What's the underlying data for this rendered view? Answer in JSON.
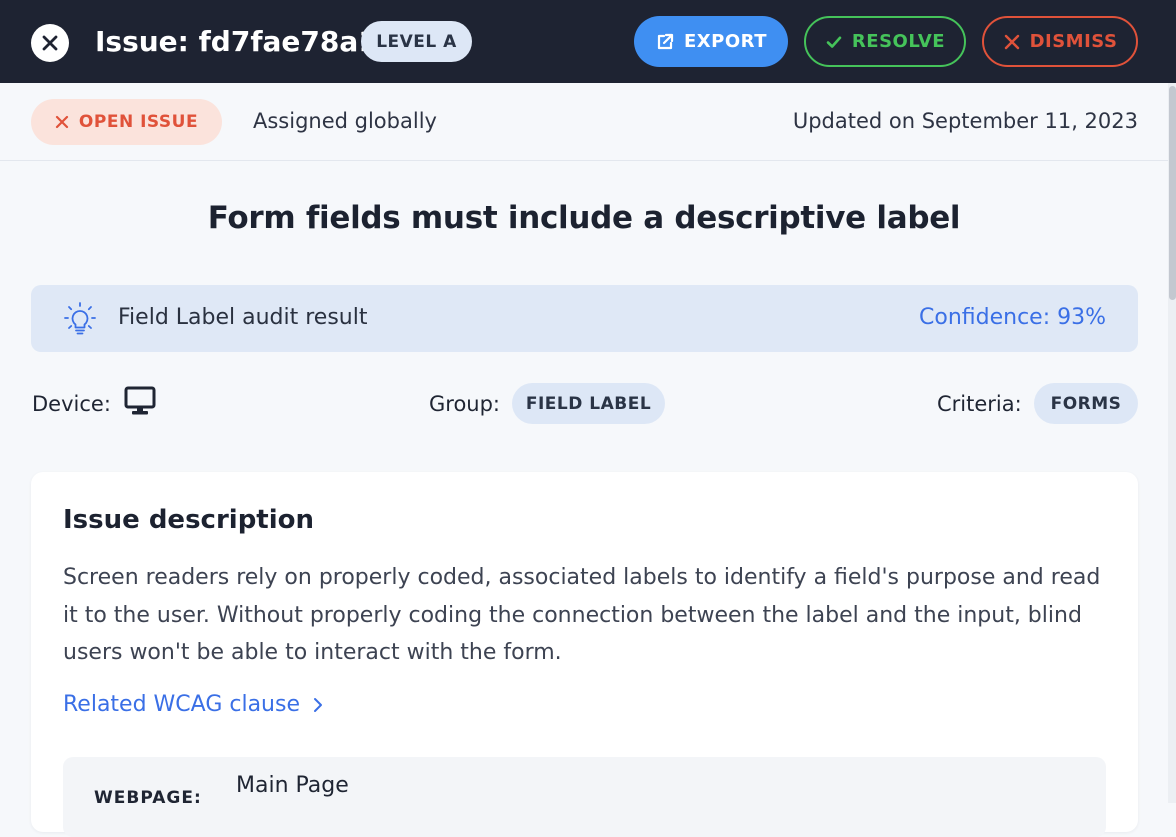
{
  "header": {
    "title": "Issue: fd7fae78a1",
    "level_badge": "LEVEL A",
    "buttons": {
      "export": "EXPORT",
      "resolve": "RESOLVE",
      "dismiss": "DISMISS"
    }
  },
  "status": {
    "badge": "OPEN ISSUE",
    "assigned": "Assigned globally",
    "updated": "Updated on September 11, 2023"
  },
  "rule_title": "Form fields must include a descriptive label",
  "audit": {
    "label": "Field Label audit result",
    "confidence": "Confidence: 93%"
  },
  "meta": {
    "device_label": "Device:",
    "group_label": "Group:",
    "group_value": "FIELD LABEL",
    "criteria_label": "Criteria:",
    "criteria_value": "FORMS"
  },
  "card": {
    "title": "Issue description",
    "description": "Screen readers rely on properly coded, associated labels to identify a field's purpose and read it to the user. Without properly coding the connection between the label and the input, blind users won't be able to interact with the form.",
    "link": "Related WCAG clause",
    "webpage_label": "WEBPAGE:",
    "webpage_value": "Main Page"
  },
  "icons": {
    "close": "close-icon",
    "export": "export-icon",
    "resolve": "check-icon",
    "dismiss": "x-icon",
    "open_badge": "x-icon",
    "audit": "lightbulb-icon",
    "device": "desktop-monitor-icon",
    "link": "chevron-right-icon"
  },
  "colors": {
    "header_bg": "#1e2332",
    "primary": "#3f8ff2",
    "success": "#45c35a",
    "danger": "#e0523a",
    "link": "#3a6fe6",
    "badge_bg": "#dde7f6",
    "audit_bg": "#dfe8f6"
  }
}
